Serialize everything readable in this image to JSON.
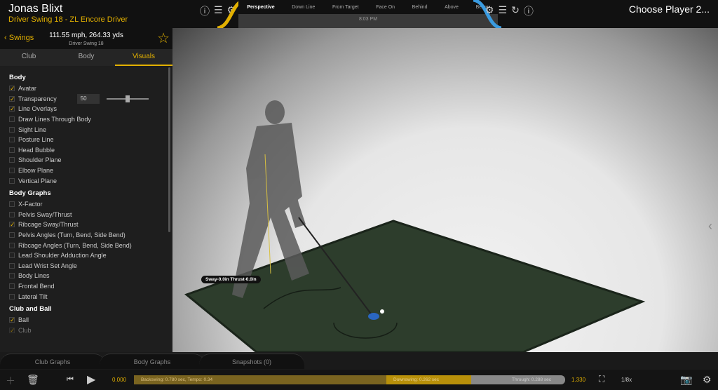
{
  "header": {
    "player": "Jonas Blixt",
    "swing_title": "Driver Swing 18 - ZL Encore Driver",
    "choose_player": "Choose Player 2...",
    "clock": "8:03 PM",
    "views": [
      "Perspective",
      "Down Line",
      "From Target",
      "Face On",
      "Behind",
      "Above",
      "Below"
    ],
    "active_view": "Perspective"
  },
  "swing": {
    "back": "Swings",
    "stats": "111.55 mph, 264.33 yds",
    "name": "Driver Swing 18"
  },
  "tabs": [
    "Club",
    "Body",
    "Visuals"
  ],
  "visuals": {
    "sections": [
      {
        "title": "Body",
        "items": [
          {
            "label": "Avatar",
            "checked": true
          },
          {
            "label": "Transparency",
            "checked": true,
            "value": "50",
            "slider": 0.5
          },
          {
            "label": "Line Overlays",
            "checked": true
          },
          {
            "label": "Draw Lines Through Body",
            "checked": false
          },
          {
            "label": "Sight Line",
            "checked": false
          },
          {
            "label": "Posture Line",
            "checked": false
          },
          {
            "label": "Head Bubble",
            "checked": false
          },
          {
            "label": "Shoulder Plane",
            "checked": false
          },
          {
            "label": "Elbow Plane",
            "checked": false
          },
          {
            "label": "Vertical Plane",
            "checked": false
          }
        ]
      },
      {
        "title": "Body Graphs",
        "items": [
          {
            "label": "X-Factor",
            "checked": false
          },
          {
            "label": "Pelvis Sway/Thrust",
            "checked": false
          },
          {
            "label": "Ribcage Sway/Thrust",
            "checked": true
          },
          {
            "label": "Pelvis Angles (Turn, Bend, Side Bend)",
            "checked": false
          },
          {
            "label": "Ribcage Angles (Turn, Bend, Side Bend)",
            "checked": false
          },
          {
            "label": "Lead Shoulder Adduction Angle",
            "checked": false
          },
          {
            "label": "Lead Wrist Set Angle",
            "checked": false
          },
          {
            "label": "Body Lines",
            "checked": false
          },
          {
            "label": "Frontal Bend",
            "checked": false
          },
          {
            "label": "Lateral Tilt",
            "checked": false
          }
        ]
      },
      {
        "title": "Club and Ball",
        "items": [
          {
            "label": "Ball",
            "checked": true
          },
          {
            "label": "Club",
            "checked": true
          }
        ]
      }
    ]
  },
  "overlay": {
    "sway": "Sway-0.0in Thrust-0.0in"
  },
  "graph_tabs": [
    "Club Graphs",
    "Body Graphs",
    "Snapshots (0)"
  ],
  "timeline": {
    "start": "0.000",
    "end": "1.330",
    "backswing": "Backswing: 0.780 sec, Tempo: 0.34",
    "downswing": "Downswing: 0.262 sec",
    "through": "Through: 0.288 sec",
    "speed": "1/8x"
  },
  "colors": {
    "accent": "#e2b000",
    "blue": "#3a9be0"
  }
}
